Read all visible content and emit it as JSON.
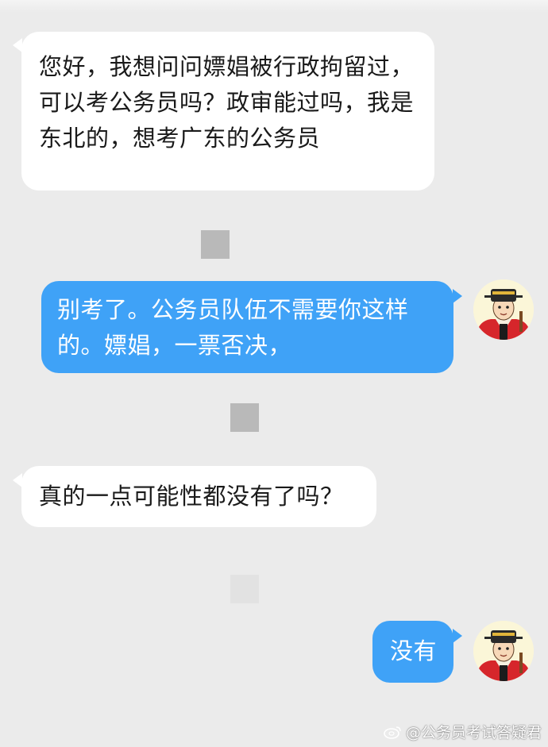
{
  "chat": {
    "messages": [
      {
        "side": "left",
        "text": "您好，我想问问嫖娼被行政拘留过，可以考公务员吗？政审能过吗，我是东北的，想考广东的公务员"
      },
      {
        "side": "right",
        "text": "别考了。公务员队伍不需要你这样的。嫖娼，一票否决，"
      },
      {
        "side": "left",
        "text": "真的一点可能性都没有了吗？"
      },
      {
        "side": "right",
        "text": "没有"
      }
    ]
  },
  "colors": {
    "background": "#ebebeb",
    "incoming_bubble": "#ffffff",
    "outgoing_bubble": "#3fa2f7"
  },
  "avatar": {
    "icon": "official-cartoon-avatar"
  },
  "watermark": {
    "icon": "weibo-icon",
    "text": "@公务员考试答疑君"
  }
}
